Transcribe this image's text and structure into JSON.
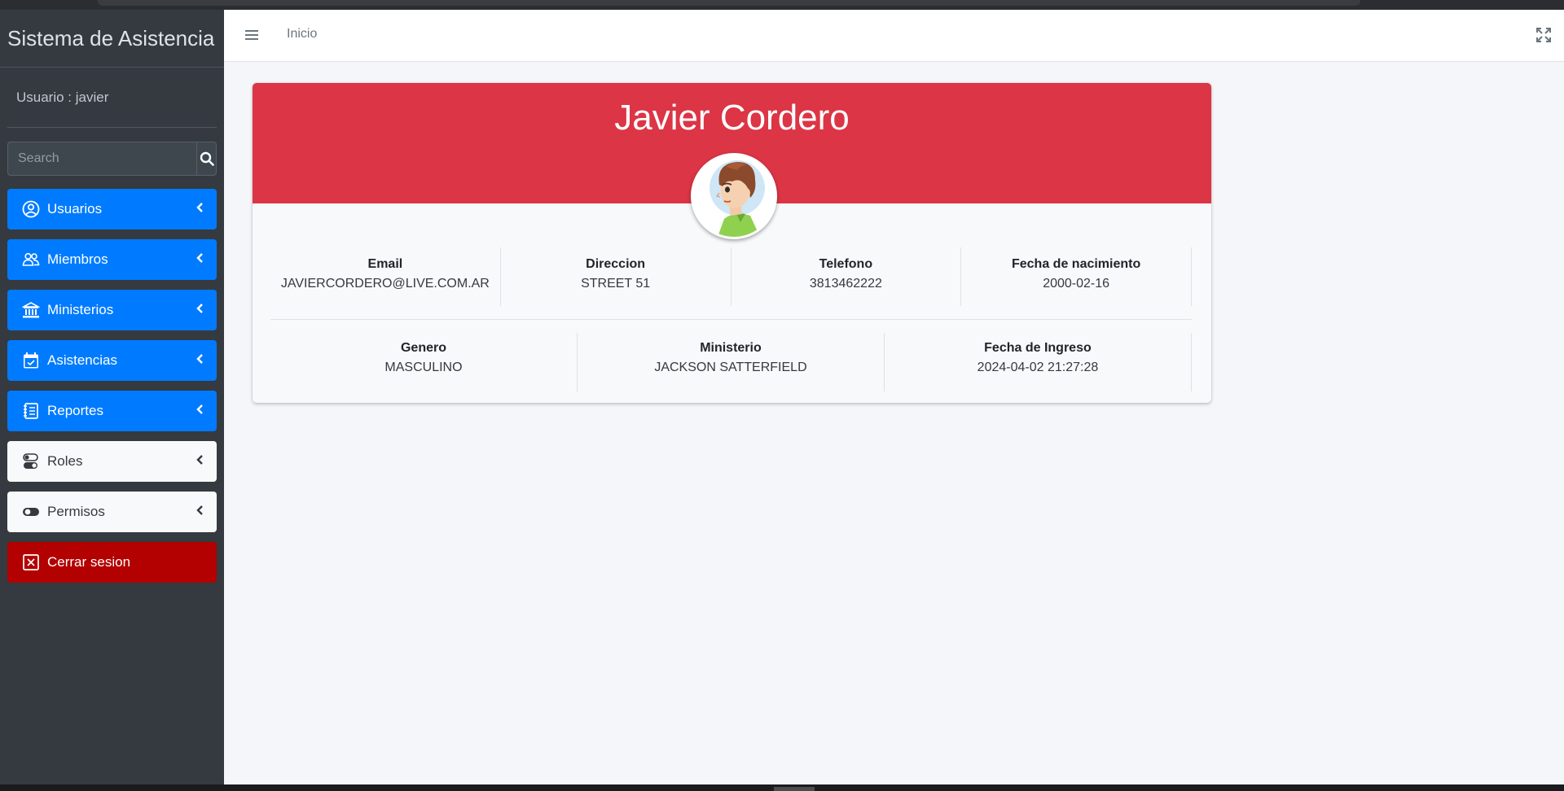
{
  "sidebar": {
    "brand": "Sistema de Asistencia",
    "user": "Usuario : javier",
    "search_placeholder": "Search",
    "items": [
      {
        "label": "Usuarios",
        "icon": "user-circle-icon",
        "style": "blue"
      },
      {
        "label": "Miembros",
        "icon": "users-icon",
        "style": "blue"
      },
      {
        "label": "Ministerios",
        "icon": "building-columns-icon",
        "style": "blue"
      },
      {
        "label": "Asistencias",
        "icon": "calendar-check-icon",
        "style": "blue"
      },
      {
        "label": "Reportes",
        "icon": "report-icon",
        "style": "blue"
      },
      {
        "label": "Roles",
        "icon": "toggles-icon",
        "style": "white"
      },
      {
        "label": "Permisos",
        "icon": "toggle-icon",
        "style": "white"
      },
      {
        "label": "Cerrar sesion",
        "icon": "close-box-icon",
        "style": "red"
      }
    ]
  },
  "navbar": {
    "link": "Inicio"
  },
  "profile": {
    "name": "Javier Cordero",
    "fields_row1": [
      {
        "label": "Email",
        "value": "JAVIERCORDERO@LIVE.COM.AR"
      },
      {
        "label": "Direccion",
        "value": "STREET 51"
      },
      {
        "label": "Telefono",
        "value": "3813462222"
      },
      {
        "label": "Fecha de nacimiento",
        "value": "2000-02-16"
      }
    ],
    "fields_row2": [
      {
        "label": "Genero",
        "value": "MASCULINO"
      },
      {
        "label": "Ministerio",
        "value": "JACKSON SATTERFIELD"
      },
      {
        "label": "Fecha de Ingreso",
        "value": "2024-04-02 21:27:28"
      }
    ]
  },
  "colors": {
    "sidebar_bg": "#343a40",
    "primary": "#007bff",
    "danger_header": "#dc3545",
    "logout": "#b30000"
  }
}
